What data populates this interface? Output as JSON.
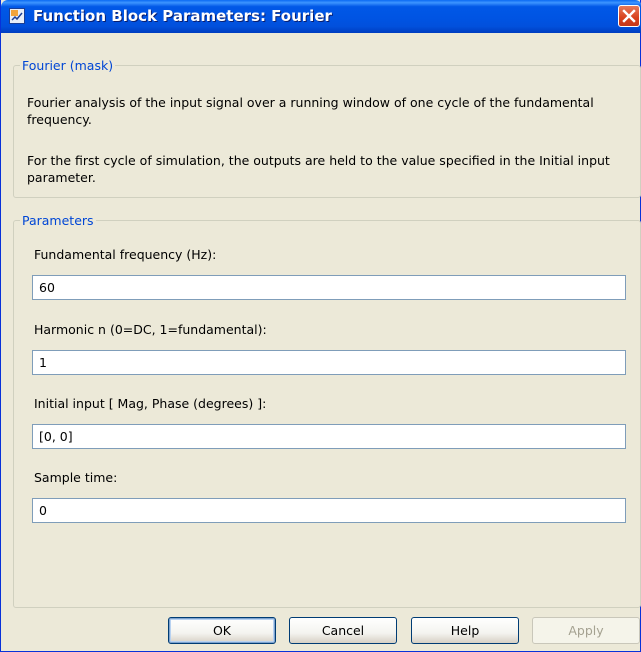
{
  "window": {
    "title": "Function Block Parameters: Fourier"
  },
  "mask": {
    "legend": "Fourier (mask)",
    "description1": "Fourier analysis of the input signal over a running window of one cycle of the fundamental frequency.",
    "description2": "For the first cycle of simulation, the outputs are held  to the value specified in the Initial input parameter."
  },
  "parameters": {
    "legend": "Parameters",
    "fields": [
      {
        "label": "Fundamental frequency (Hz):",
        "value": "60"
      },
      {
        "label": "Harmonic n (0=DC, 1=fundamental):",
        "value": "1"
      },
      {
        "label": "Initial input [ Mag, Phase (degrees) ]:",
        "value": "[0, 0]"
      },
      {
        "label": "Sample time:",
        "value": "0"
      }
    ]
  },
  "buttons": {
    "ok": "OK",
    "cancel": "Cancel",
    "help": "Help",
    "apply": "Apply"
  },
  "icons": {
    "title": "simulink-block-icon",
    "close": "close-icon"
  },
  "colors": {
    "titlebar": "#0054E3",
    "legend": "#0046D5",
    "close": "#D8411C",
    "background": "#ECE9D8"
  }
}
